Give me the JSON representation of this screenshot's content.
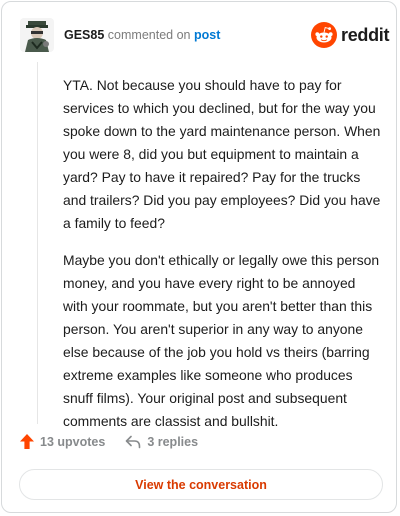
{
  "header": {
    "username": "GES85",
    "action_text": "commented on",
    "post_link": "post"
  },
  "brand": {
    "name": "reddit",
    "icon": "reddit-snoo-icon",
    "color": "#ff4500"
  },
  "avatar": {
    "icon": "user-avatar-icon"
  },
  "comment": {
    "paragraphs": [
      "YTA. Not because you should have to pay for services to which you declined, but for the way you spoke down to the yard maintenance person. When you were 8, did you but equipment to maintain a yard? Pay to have it repaired? Pay for the trucks and trailers? Did you pay employees? Did you have a family to feed?",
      "Maybe you don't ethically or legally owe this person money, and you have every right to be annoyed with your roommate, but you aren't better than this person. You aren't superior in any way to anyone else because of the job you hold vs theirs (barring extreme examples like someone who produces snuff films). Your original post and subsequent comments are classist and bullshit."
    ]
  },
  "actions": {
    "upvotes": "13 upvotes",
    "upvote_icon": "upvote-arrow-icon",
    "upvote_color": "#ff4500",
    "replies": "3 replies",
    "reply_icon": "reply-arrow-icon"
  },
  "footer": {
    "button_label": "View the conversation",
    "button_color": "#d93a00"
  }
}
